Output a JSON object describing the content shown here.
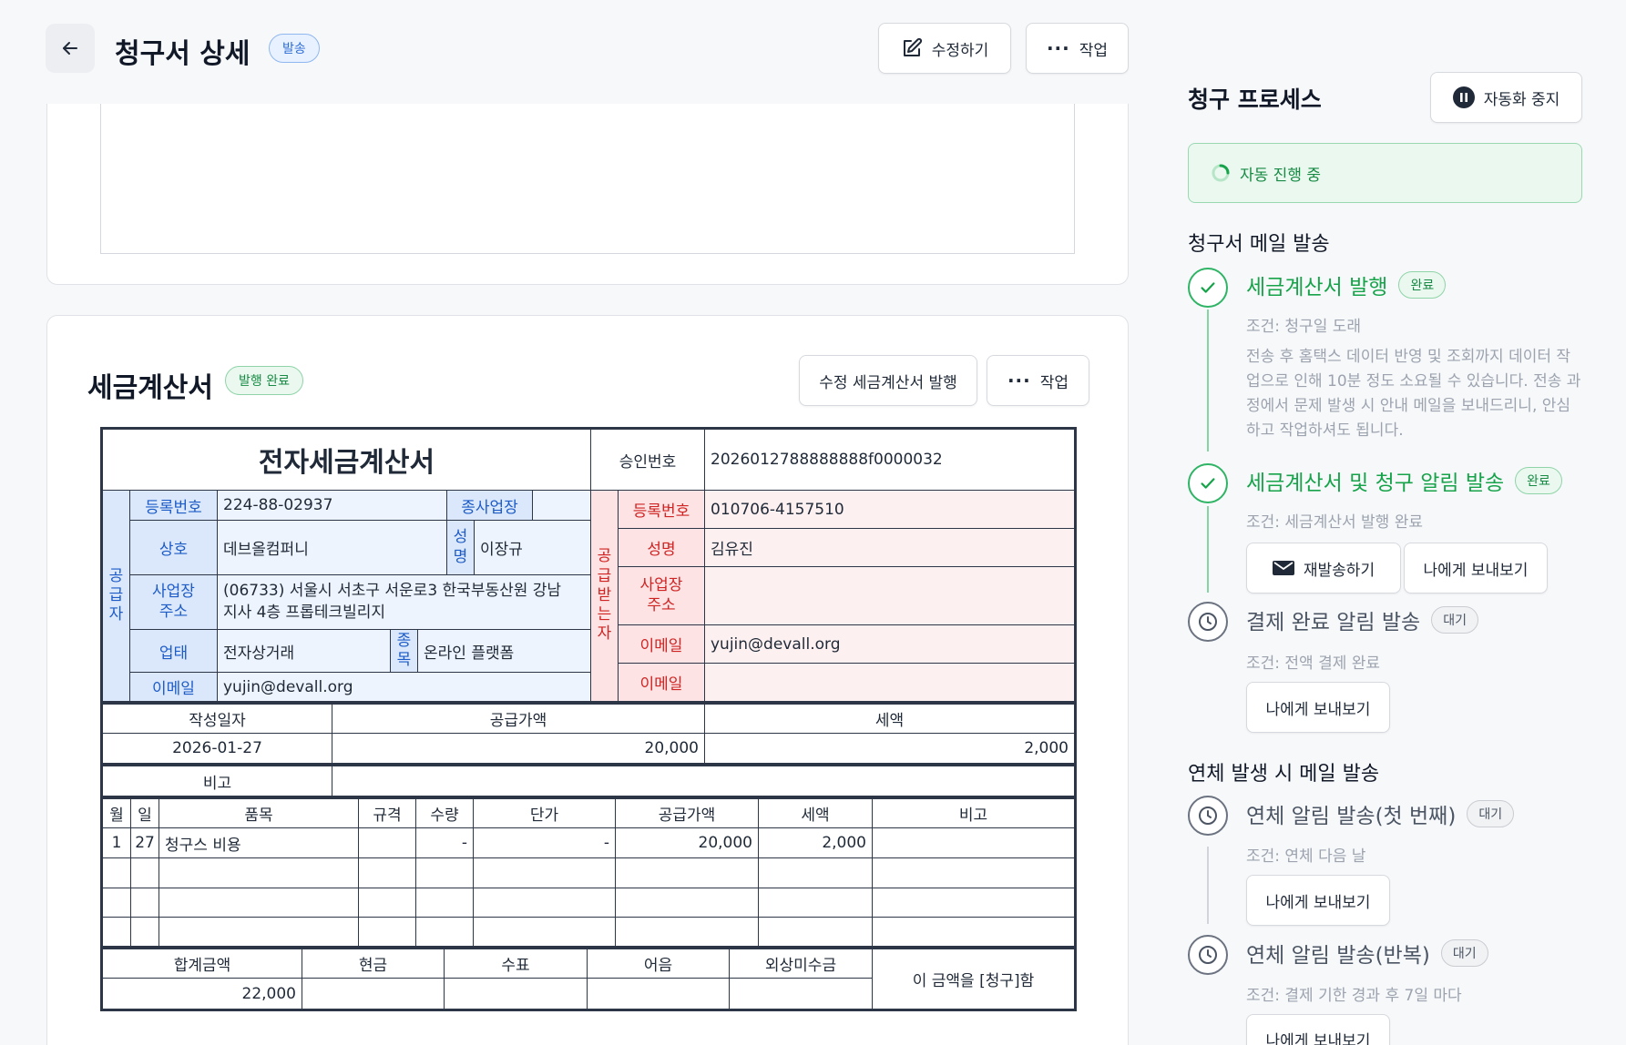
{
  "header": {
    "title": "청구서 상세",
    "status_badge": "발송",
    "edit_button": "수정하기",
    "actions_button": "작업"
  },
  "tax_invoice_section": {
    "title": "세금계산서",
    "badge": "발행 완료",
    "amend_button": "수정 세금계산서 발행",
    "actions_button": "작업"
  },
  "invoice": {
    "doc_title": "전자세금계산서",
    "approval_label": "승인번호",
    "approval_number": "2026012788888888f0000032",
    "supplier": {
      "side_label": [
        "공",
        "급",
        "자"
      ],
      "reg_no_label": "등록번호",
      "reg_no": "224-88-02937",
      "branch_label": "종사업장",
      "company_label": "상호",
      "company": "데브올컴퍼니",
      "name_label": [
        "성",
        "명"
      ],
      "name": "이장규",
      "address_label": [
        "사업장",
        "주소"
      ],
      "address_line1": "(06733) 서울시 서초구 서운로3 한국부동산원 강남",
      "address_line2": "지사 4층 프롭테크빌리지",
      "biz_type_label": "업태",
      "biz_type": "전자상거래",
      "item_label": [
        "종",
        "목"
      ],
      "item": "온라인 플랫폼",
      "email_label": "이메일",
      "email": "yujin@devall.org"
    },
    "receiver": {
      "side_label": [
        "공",
        "급",
        "받",
        "는",
        "자"
      ],
      "reg_no_label": "등록번호",
      "reg_no": "010706-4157510",
      "name_label": "성명",
      "name": "김유진",
      "address_label": [
        "사업장",
        "주소"
      ],
      "address": "",
      "email_label": "이메일",
      "email": "yujin@devall.org",
      "email2_label": "이메일",
      "email2": ""
    },
    "summary": {
      "date_label": "작성일자",
      "supply_label": "공급가액",
      "tax_label": "세액",
      "date": "2026-01-27",
      "supply": "20,000",
      "tax": "2,000",
      "note_label": "비고",
      "note": ""
    },
    "items_header": [
      "월",
      "일",
      "품목",
      "규격",
      "수량",
      "단가",
      "공급가액",
      "세액",
      "비고"
    ],
    "items": [
      [
        "1",
        "27",
        "청구스 비용",
        "",
        "-",
        "-",
        "20,000",
        "2,000",
        ""
      ],
      [
        "",
        "",
        "",
        "",
        "",
        "",
        "",
        "",
        ""
      ],
      [
        "",
        "",
        "",
        "",
        "",
        "",
        "",
        "",
        ""
      ],
      [
        "",
        "",
        "",
        "",
        "",
        "",
        "",
        "",
        ""
      ]
    ],
    "totals": {
      "total_label": "합계금액",
      "cash_label": "현금",
      "check_label": "수표",
      "bill_label": "어음",
      "credit_label": "외상미수금",
      "total": "22,000",
      "claim_text": "이 금액을 [청구]함"
    }
  },
  "process": {
    "title": "청구 프로세스",
    "stop_button": "자동화 중지",
    "auto_status": "자동 진행 중",
    "section1_title": "청구서 메일 발송",
    "section2_title": "연체 발생 시 메일 발송",
    "steps": [
      {
        "title": "세금계산서 발행",
        "badge": "완료",
        "condition": "조건: 청구일 도래",
        "desc": "전송 후 홈택스 데이터 반영 및 조회까지 데이터 작업으로 인해 10분 정도 소요될 수 있습니다. 전송 과정에서 문제 발생 시 안내 메일을 보내드리니, 안심하고 작업하셔도 됩니다."
      },
      {
        "title": "세금계산서 및 청구 알림 발송",
        "badge": "완료",
        "condition": "조건: 세금계산서 발행 완료",
        "resend_button": "재발송하기",
        "preview_button": "나에게 보내보기"
      },
      {
        "title": "결제 완료 알림 발송",
        "badge": "대기",
        "condition": "조건: 전액 결제 완료",
        "preview_button": "나에게 보내보기"
      },
      {
        "title": "연체 알림 발송(첫 번째)",
        "badge": "대기",
        "condition": "조건: 연체 다음 날",
        "preview_button": "나에게 보내보기"
      },
      {
        "title": "연체 알림 발송(반복)",
        "badge": "대기",
        "condition": "조건: 결제 기한 경과 후 7일 마다",
        "preview_button": "나에게 보내보기"
      }
    ]
  },
  "colors": {
    "accent_green": "#16a34a",
    "supplier_blue": "#1d5bc7",
    "receiver_red": "#d02323",
    "badge_blue": "#2b6cd6"
  }
}
